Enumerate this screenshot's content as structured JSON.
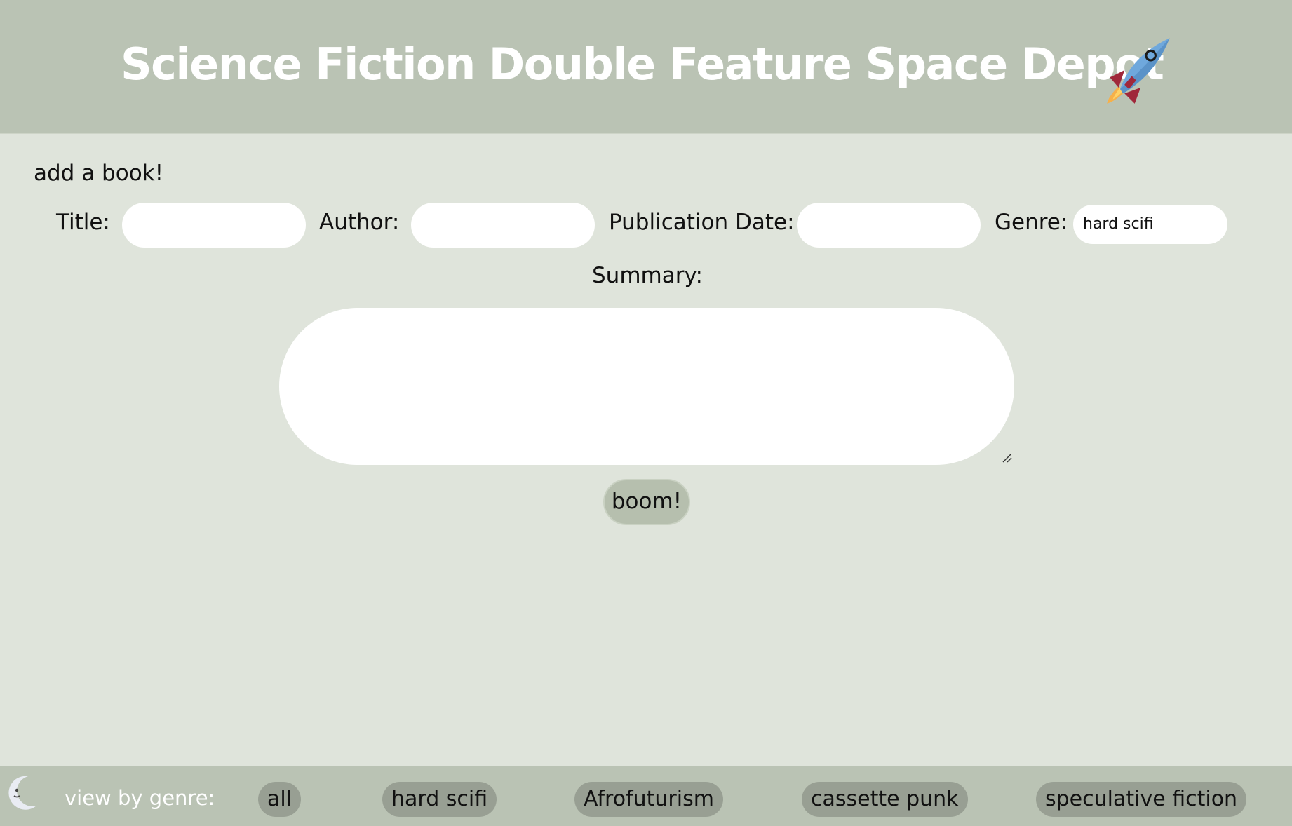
{
  "header": {
    "title": "Science Fiction Double Feature Space Depot"
  },
  "form": {
    "heading": "add a book!",
    "title_label": "Title:",
    "title_value": "",
    "author_label": "Author:",
    "author_value": "",
    "date_label": "Publication Date:",
    "date_value": "",
    "genre_label": "Genre:",
    "genre_selected": "hard scifi",
    "summary_label": "Summary:",
    "summary_value": "",
    "submit_label": "boom!"
  },
  "footer": {
    "view_label": "view by genre:",
    "genres": [
      "all",
      "hard scifi",
      "Afrofuturism",
      "cassette punk",
      "speculative fiction"
    ]
  },
  "colors": {
    "header_bg": "#bac3b4",
    "page_bg": "#dfe4db",
    "chip_bg": "#989f93",
    "button_bg": "#b6bfae"
  },
  "icons": {
    "header": "rocket-icon",
    "footer": "moon-icon"
  }
}
